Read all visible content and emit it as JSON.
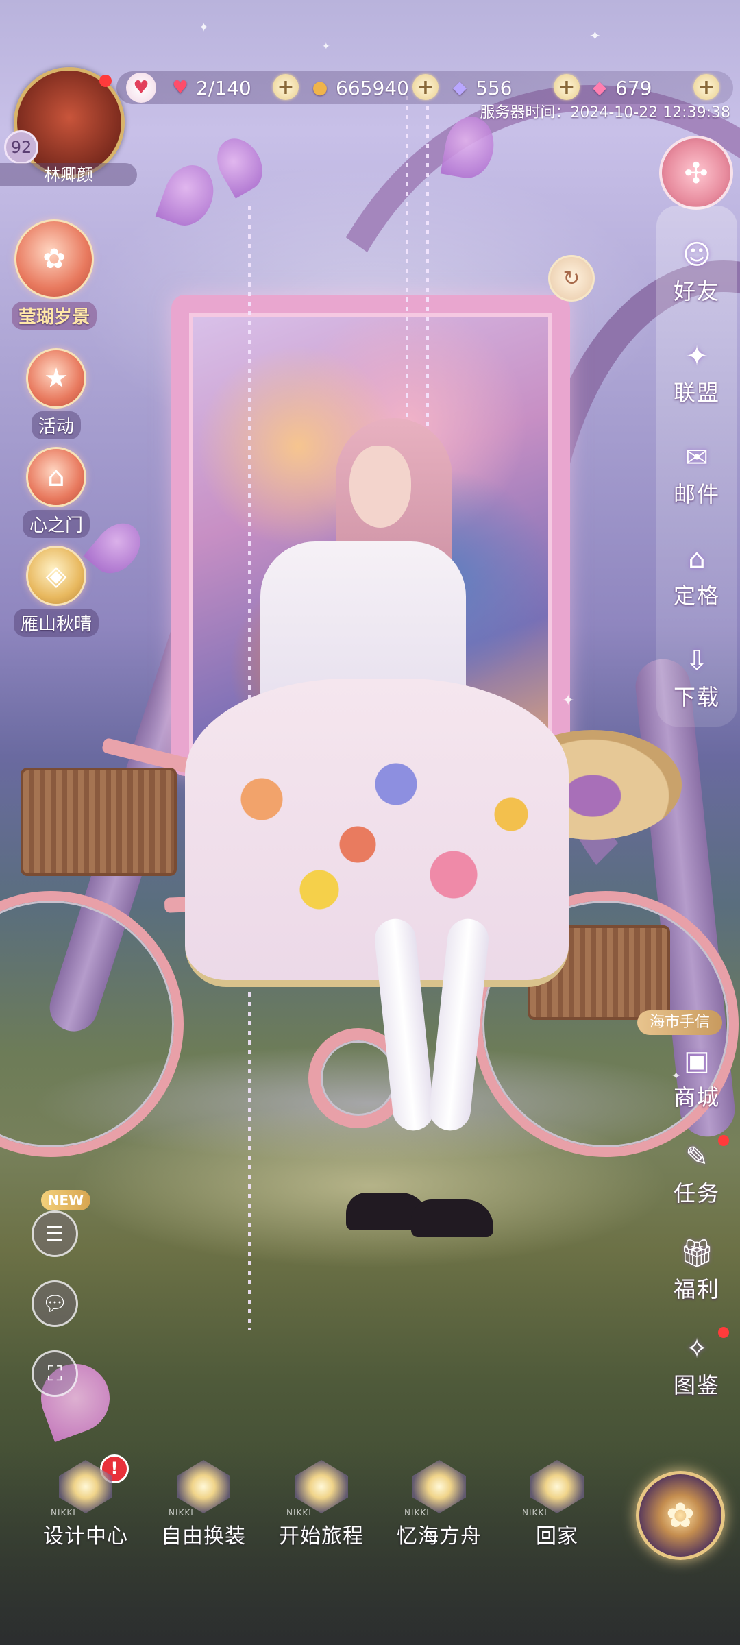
{
  "player": {
    "name": "林卿颜",
    "level": "92"
  },
  "resources": {
    "stamina": "2/140",
    "gold": "665940",
    "diamonds": "556",
    "crystals": "679"
  },
  "server_time": "服务器时间：2024-10-22 12:39:38",
  "left_buttons": [
    {
      "label": "莹瑚岁景",
      "icon": "coral-icon"
    },
    {
      "label": "活动",
      "icon": "star-icon"
    },
    {
      "label": "心之门",
      "icon": "door-icon"
    },
    {
      "label": "雁山秋晴",
      "icon": "diamond-icon"
    }
  ],
  "right_buttons": [
    {
      "label": "好友",
      "icon": "friend-icon"
    },
    {
      "label": "联盟",
      "icon": "alliance-icon"
    },
    {
      "label": "邮件",
      "icon": "mail-icon"
    },
    {
      "label": "定格",
      "icon": "home-icon"
    },
    {
      "label": "下载",
      "icon": "download-icon"
    },
    {
      "label": "商城",
      "icon": "shop-icon"
    },
    {
      "label": "任务",
      "icon": "task-icon"
    },
    {
      "label": "福利",
      "icon": "gift-icon"
    },
    {
      "label": "图鉴",
      "icon": "collection-icon"
    }
  ],
  "shop_tag": "海市手信",
  "new_badge": "NEW",
  "bottom_nav": [
    {
      "label": "设计中心",
      "brand": "NIKKI",
      "alert": "!"
    },
    {
      "label": "自由换装",
      "brand": "NIKKI"
    },
    {
      "label": "开始旅程",
      "brand": "NIKKI"
    },
    {
      "label": "忆海方舟",
      "brand": "NIKKI"
    },
    {
      "label": "回家",
      "brand": "NIKKI"
    }
  ]
}
